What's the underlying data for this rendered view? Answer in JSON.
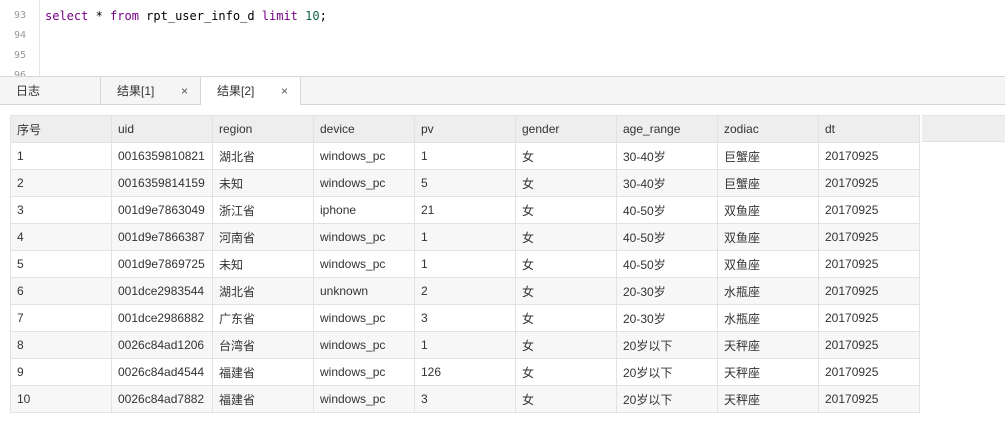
{
  "editor": {
    "lines": [
      {
        "number": "93",
        "parts": [
          {
            "text": "select",
            "kind": "kw"
          },
          {
            "text": " * ",
            "kind": "plain"
          },
          {
            "text": "from",
            "kind": "kw"
          },
          {
            "text": " rpt_user_info_d ",
            "kind": "plain"
          },
          {
            "text": "limit",
            "kind": "kw"
          },
          {
            "text": " ",
            "kind": "plain"
          },
          {
            "text": "10",
            "kind": "num"
          },
          {
            "text": ";",
            "kind": "plain"
          }
        ]
      },
      {
        "number": "94",
        "parts": []
      },
      {
        "number": "95",
        "parts": []
      },
      {
        "number": "96",
        "parts": []
      }
    ]
  },
  "tabs": [
    {
      "label": "日志",
      "closable": false,
      "active": false
    },
    {
      "label": "结果[1]",
      "closable": true,
      "active": false
    },
    {
      "label": "结果[2]",
      "closable": true,
      "active": true
    }
  ],
  "close_glyph": "×",
  "results": {
    "columns": [
      "序号",
      "uid",
      "region",
      "device",
      "pv",
      "gender",
      "age_range",
      "zodiac",
      "dt"
    ],
    "rows": [
      [
        "1",
        "0016359810821",
        "湖北省",
        "windows_pc",
        "1",
        "女",
        "30-40岁",
        "巨蟹座",
        "20170925"
      ],
      [
        "2",
        "0016359814159",
        "未知",
        "windows_pc",
        "5",
        "女",
        "30-40岁",
        "巨蟹座",
        "20170925"
      ],
      [
        "3",
        "001d9e7863049",
        "浙江省",
        "iphone",
        "21",
        "女",
        "40-50岁",
        "双鱼座",
        "20170925"
      ],
      [
        "4",
        "001d9e7866387",
        "河南省",
        "windows_pc",
        "1",
        "女",
        "40-50岁",
        "双鱼座",
        "20170925"
      ],
      [
        "5",
        "001d9e7869725",
        "未知",
        "windows_pc",
        "1",
        "女",
        "40-50岁",
        "双鱼座",
        "20170925"
      ],
      [
        "6",
        "001dce2983544",
        "湖北省",
        "unknown",
        "2",
        "女",
        "20-30岁",
        "水瓶座",
        "20170925"
      ],
      [
        "7",
        "001dce2986882",
        "广东省",
        "windows_pc",
        "3",
        "女",
        "20-30岁",
        "水瓶座",
        "20170925"
      ],
      [
        "8",
        "0026c84ad1206",
        "台湾省",
        "windows_pc",
        "1",
        "女",
        "20岁以下",
        "天秤座",
        "20170925"
      ],
      [
        "9",
        "0026c84ad4544",
        "福建省",
        "windows_pc",
        "126",
        "女",
        "20岁以下",
        "天秤座",
        "20170925"
      ],
      [
        "10",
        "0026c84ad7882",
        "福建省",
        "windows_pc",
        "3",
        "女",
        "20岁以下",
        "天秤座",
        "20170925"
      ]
    ]
  }
}
